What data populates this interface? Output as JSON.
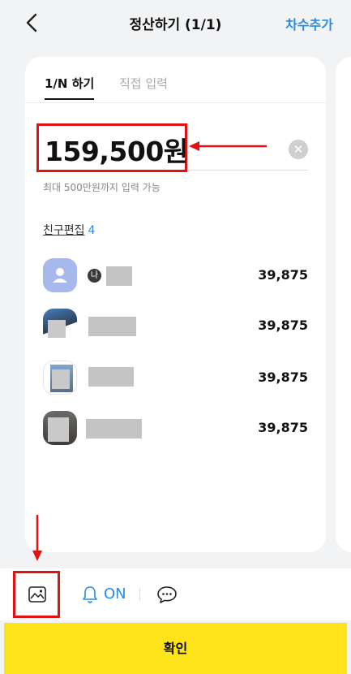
{
  "header": {
    "title": "정산하기 (1/1)",
    "add_round_label": "차수추가"
  },
  "tabs": [
    {
      "label": "1/N 하기",
      "active": true
    },
    {
      "label": "직접 입력",
      "active": false
    }
  ],
  "amount": {
    "value": "159,500원",
    "hint": "최대 500만원까지 입력 가능"
  },
  "friends_header": {
    "label": "친구편집",
    "count": "4"
  },
  "friends": [
    {
      "is_me": true,
      "me_badge": "나",
      "amount": "39,875"
    },
    {
      "is_me": false,
      "amount": "39,875"
    },
    {
      "is_me": false,
      "amount": "39,875"
    },
    {
      "is_me": false,
      "amount": "39,875"
    }
  ],
  "toolbar": {
    "alarm_label": "ON"
  },
  "confirm_label": "확인",
  "colors": {
    "accent_blue": "#2a8ce0",
    "confirm_yellow": "#fde31a",
    "annotation_red": "#e31212"
  },
  "icons": [
    "back-icon",
    "clear-icon",
    "photo-icon",
    "bell-icon",
    "chat-icon"
  ]
}
